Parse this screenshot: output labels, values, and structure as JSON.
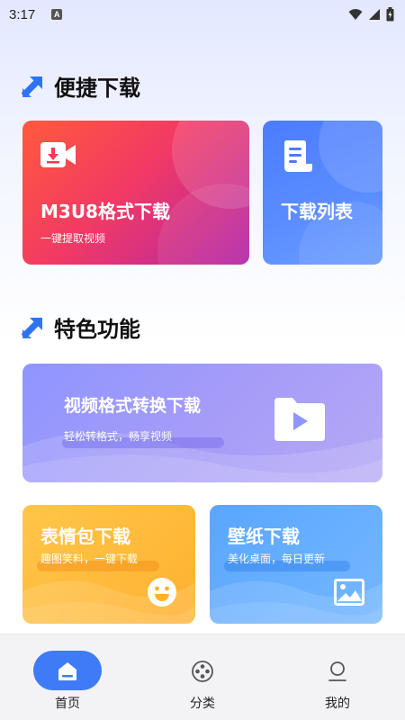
{
  "status_bar": {
    "time": "3:17",
    "notification_badge": "A"
  },
  "sections": {
    "quick_download": {
      "title": "便捷下载"
    },
    "features": {
      "title": "特色功能"
    }
  },
  "cards": {
    "m3u8": {
      "title": "M3U8格式下载",
      "subtitle": "一键提取视频"
    },
    "download_list": {
      "title": "下载列表"
    },
    "video_convert": {
      "title": "视频格式转换下载",
      "subtitle": "轻松转格式，畅享视频"
    },
    "emoji": {
      "title": "表情包下载",
      "subtitle": "趣图笑料，一键下载"
    },
    "wallpaper": {
      "title": "壁纸下载",
      "subtitle": "美化桌面，每日更新"
    }
  },
  "bottom_nav": {
    "items": [
      {
        "label": "首页",
        "icon": "home-icon",
        "active": true
      },
      {
        "label": "分类",
        "icon": "film-reel-icon",
        "active": false
      },
      {
        "label": "我的",
        "icon": "person-icon",
        "active": false
      }
    ]
  },
  "colors": {
    "accent": "#3f7bf6",
    "m3u8_gradient": [
      "#ff5a3c",
      "#b326a8"
    ],
    "list_card": "#4b7cff",
    "convert_card": "#9a98fb",
    "emoji_card": "#ffbb3a",
    "wallpaper_card": "#62acff"
  }
}
